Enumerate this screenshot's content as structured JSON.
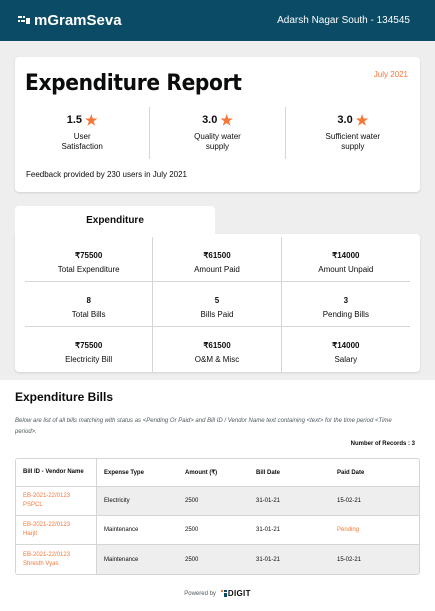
{
  "header": {
    "brand": "mGramSeva",
    "location": "Adarsh Nagar South - 134545"
  },
  "report": {
    "title": "Expenditure Report",
    "month": "July 2021",
    "ratings": [
      {
        "value": "1.5",
        "label_line1": "User",
        "label_line2": "Satisfaction"
      },
      {
        "value": "3.0",
        "label_line1": "Quality water",
        "label_line2": "supply"
      },
      {
        "value": "3.0",
        "label_line1": "Sufficient water",
        "label_line2": "supply"
      }
    ],
    "feedback": "Feedback provided by 230 users in July 2021"
  },
  "summary": {
    "tab_label": "Expenditure",
    "cells": [
      {
        "value": "₹75500",
        "label": "Total Expenditure"
      },
      {
        "value": "₹61500",
        "label": "Amount Paid"
      },
      {
        "value": "₹14000",
        "label": "Amount Unpaid"
      },
      {
        "value": "8",
        "label": "Total Bills"
      },
      {
        "value": "5",
        "label": "Bills Paid"
      },
      {
        "value": "3",
        "label": "Pending Bills"
      },
      {
        "value": "₹75500",
        "label": "Electricity Bill"
      },
      {
        "value": "₹61500",
        "label": "O&M & Misc"
      },
      {
        "value": "₹14000",
        "label": "Salary"
      }
    ]
  },
  "bills": {
    "title": "Expenditure Bills",
    "description": "Below are list of all bills matching with status as <Pending Or Paid> and Bill ID / Vendor Name text containing <text> for the time period <Time period>.",
    "records": "Number of Records : 3",
    "columns": [
      "Bill ID - Vendor Name",
      "Expense Type",
      "Amount (₹)",
      "Bill Date",
      "Paid Date"
    ],
    "rows": [
      {
        "bill_id": "EB-2021-22/0123",
        "vendor": "PSPCL",
        "expense_type": "Electricity",
        "amount": "2500",
        "bill_date": "31-01-21",
        "paid_date": "15-02-21"
      },
      {
        "bill_id": "EB-2021-22/0123",
        "vendor": "Harjit",
        "expense_type": "Maintenance",
        "amount": "2500",
        "bill_date": "31-01-21",
        "paid_date": "Pending"
      },
      {
        "bill_id": "EB-2021-22/0123",
        "vendor": "Shresth Vyas",
        "expense_type": "Maintenance",
        "amount": "2500",
        "bill_date": "31-01-21",
        "paid_date": "15-02-21"
      }
    ]
  },
  "footer": {
    "powered_by": "Powered by",
    "digit": "DIGIT"
  },
  "colors": {
    "header_bg": "#0b4b66",
    "accent": "#f47738"
  },
  "icons": {
    "brand": "mgramseva-logo-icon",
    "rating": "star-icon",
    "digit": "digit-logo-icon"
  }
}
